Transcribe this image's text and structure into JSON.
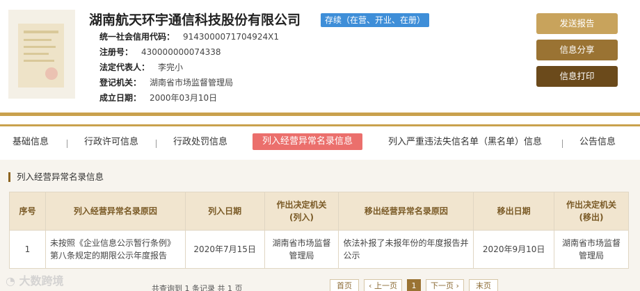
{
  "company": {
    "name": "湖南航天环宇通信科技股份有限公司",
    "status": "存续（在营、开业、在册）",
    "fields": [
      {
        "label": "统一社会信用代码：",
        "value": "9143000071704924X1"
      },
      {
        "label": "注册号：",
        "value": "430000000074338"
      },
      {
        "label": "法定代表人：",
        "value": "李完小"
      },
      {
        "label": "登记机关：",
        "value": "湖南省市场监督管理局"
      },
      {
        "label": "成立日期：",
        "value": "2000年03月10日"
      }
    ]
  },
  "actions": {
    "send_report": "发送报告",
    "share_info": "信息分享",
    "print_info": "信息打印"
  },
  "tabs": [
    "基础信息",
    "行政许可信息",
    "行政处罚信息",
    "列入经营异常名录信息",
    "列入严重违法失信名单（黑名单）信息",
    "公告信息"
  ],
  "section": {
    "title": "列入经营异常名录信息",
    "columns": [
      "序号",
      "列入经营异常名录原因",
      "列入日期",
      "作出决定机关\n(列入)",
      "移出经营异常名录原因",
      "移出日期",
      "作出决定机关\n(移出)"
    ],
    "rows": [
      [
        "1",
        "未按照《企业信息公示暂行条例》第八条规定的期限公示年度报告",
        "2020年7月15日",
        "湖南省市场监督管理局",
        "依法补报了未报年份的年度报告并公示",
        "2020年9月10日",
        "湖南省市场监督管理局"
      ]
    ]
  },
  "pagination": {
    "summary": "共查询到 1 条记录 共 1 页",
    "first": "首页",
    "prev": "‹ 上一页",
    "current": "1",
    "next": "下一页 ›",
    "last": "末页"
  },
  "watermark": "大数跨境",
  "colors": {
    "gold": "#c9a14d",
    "active_tab": "#eb6f6c",
    "status_badge": "#3e8ed8",
    "btn_send": "#c8a35c",
    "btn_share": "#9a7333",
    "btn_print": "#6b4a1b"
  }
}
